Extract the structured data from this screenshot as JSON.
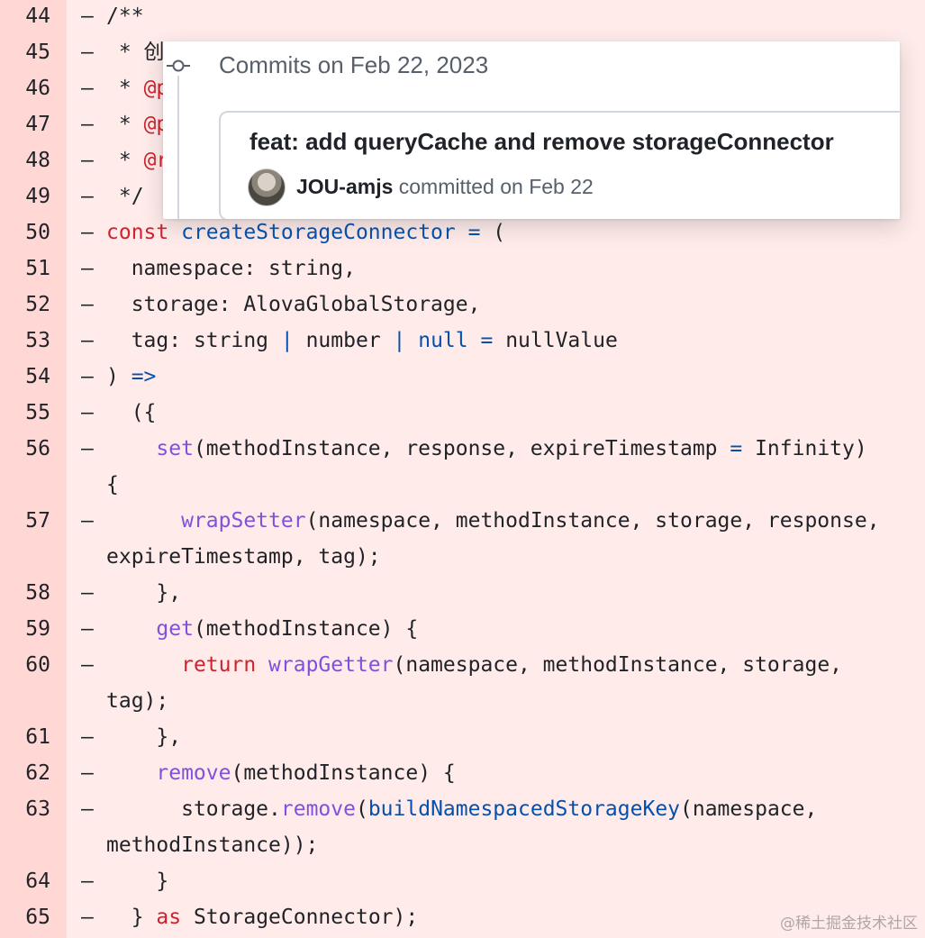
{
  "diff": {
    "rows": [
      {
        "ln": "44",
        "marker": "–",
        "tokens": [
          {
            "t": "/**",
            "c": "plain"
          }
        ]
      },
      {
        "ln": "45",
        "marker": "–",
        "tokens": [
          {
            "t": " * 创",
            "c": "plain"
          }
        ]
      },
      {
        "ln": "46",
        "marker": "–",
        "tokens": [
          {
            "t": " * ",
            "c": "plain"
          },
          {
            "t": "@p",
            "c": "kw"
          }
        ]
      },
      {
        "ln": "47",
        "marker": "–",
        "tokens": [
          {
            "t": " * ",
            "c": "plain"
          },
          {
            "t": "@p",
            "c": "kw"
          }
        ]
      },
      {
        "ln": "48",
        "marker": "–",
        "tokens": [
          {
            "t": " * ",
            "c": "plain"
          },
          {
            "t": "@r",
            "c": "kw"
          }
        ]
      },
      {
        "ln": "49",
        "marker": "–",
        "tokens": [
          {
            "t": " */",
            "c": "plain"
          }
        ]
      },
      {
        "ln": "50",
        "marker": "–",
        "tokens": [
          {
            "t": "const ",
            "c": "kw"
          },
          {
            "t": "createStorageConnector",
            "c": "const"
          },
          {
            "t": " = ",
            "c": "const"
          },
          {
            "t": "(",
            "c": "plain"
          }
        ]
      },
      {
        "ln": "51",
        "marker": "–",
        "tokens": [
          {
            "t": "  namespace: string,",
            "c": "plain"
          }
        ]
      },
      {
        "ln": "52",
        "marker": "–",
        "tokens": [
          {
            "t": "  storage: AlovaGlobalStorage,",
            "c": "plain"
          }
        ]
      },
      {
        "ln": "53",
        "marker": "–",
        "tokens": [
          {
            "t": "  tag: string ",
            "c": "plain"
          },
          {
            "t": "|",
            "c": "const"
          },
          {
            "t": " number ",
            "c": "plain"
          },
          {
            "t": "|",
            "c": "const"
          },
          {
            "t": " ",
            "c": "plain"
          },
          {
            "t": "null",
            "c": "const"
          },
          {
            "t": " ",
            "c": "plain"
          },
          {
            "t": "=",
            "c": "const"
          },
          {
            "t": " nullValue",
            "c": "plain"
          }
        ]
      },
      {
        "ln": "54",
        "marker": "–",
        "tokens": [
          {
            "t": ") ",
            "c": "plain"
          },
          {
            "t": "=>",
            "c": "const"
          }
        ]
      },
      {
        "ln": "55",
        "marker": "–",
        "tokens": [
          {
            "t": "  ({",
            "c": "plain"
          }
        ]
      },
      {
        "ln": "56",
        "marker": "–",
        "tokens": [
          {
            "t": "    ",
            "c": "plain"
          },
          {
            "t": "set",
            "c": "fn"
          },
          {
            "t": "(methodInstance, response, expireTimestamp ",
            "c": "plain"
          },
          {
            "t": "=",
            "c": "const"
          },
          {
            "t": " Infinity)",
            "c": "plain"
          }
        ],
        "wrap": [
          {
            "t": "{",
            "c": "plain"
          }
        ]
      },
      {
        "ln": "57",
        "marker": "–",
        "tokens": [
          {
            "t": "      ",
            "c": "plain"
          },
          {
            "t": "wrapSetter",
            "c": "fn"
          },
          {
            "t": "(namespace, methodInstance, storage, response,",
            "c": "plain"
          }
        ],
        "wrap": [
          {
            "t": "expireTimestamp, tag);",
            "c": "plain"
          }
        ]
      },
      {
        "ln": "58",
        "marker": "–",
        "tokens": [
          {
            "t": "    },",
            "c": "plain"
          }
        ]
      },
      {
        "ln": "59",
        "marker": "–",
        "tokens": [
          {
            "t": "    ",
            "c": "plain"
          },
          {
            "t": "get",
            "c": "fn"
          },
          {
            "t": "(methodInstance) {",
            "c": "plain"
          }
        ]
      },
      {
        "ln": "60",
        "marker": "–",
        "tokens": [
          {
            "t": "      ",
            "c": "plain"
          },
          {
            "t": "return ",
            "c": "kw"
          },
          {
            "t": "wrapGetter",
            "c": "fn"
          },
          {
            "t": "(namespace, methodInstance, storage,",
            "c": "plain"
          }
        ],
        "wrap": [
          {
            "t": "tag);",
            "c": "plain"
          }
        ]
      },
      {
        "ln": "61",
        "marker": "–",
        "tokens": [
          {
            "t": "    },",
            "c": "plain"
          }
        ]
      },
      {
        "ln": "62",
        "marker": "–",
        "tokens": [
          {
            "t": "    ",
            "c": "plain"
          },
          {
            "t": "remove",
            "c": "fn"
          },
          {
            "t": "(methodInstance) {",
            "c": "plain"
          }
        ]
      },
      {
        "ln": "63",
        "marker": "–",
        "tokens": [
          {
            "t": "      storage.",
            "c": "plain"
          },
          {
            "t": "remove",
            "c": "fn"
          },
          {
            "t": "(",
            "c": "plain"
          },
          {
            "t": "buildNamespacedStorageKey",
            "c": "const"
          },
          {
            "t": "(namespace,",
            "c": "plain"
          }
        ],
        "wrap": [
          {
            "t": "methodInstance));",
            "c": "plain"
          }
        ]
      },
      {
        "ln": "64",
        "marker": "–",
        "tokens": [
          {
            "t": "    }",
            "c": "plain"
          }
        ]
      },
      {
        "ln": "65",
        "marker": "–",
        "tokens": [
          {
            "t": "  } ",
            "c": "plain"
          },
          {
            "t": "as ",
            "c": "kw"
          },
          {
            "t": "StorageConnector);",
            "c": "plain"
          }
        ]
      }
    ]
  },
  "popover": {
    "heading": "Commits on Feb 22, 2023",
    "icon": "git-commit-icon",
    "commit": {
      "title": "feat: add queryCache and remove storageConnector",
      "author": "JOU-amjs",
      "action_text": " committed on Feb 22"
    }
  },
  "watermark": "@稀土掘金技术社区",
  "colors": {
    "background": "#ffebe9",
    "gutter": "#ffd7d5",
    "keyword": "#cf222e",
    "function": "#8250df",
    "constant": "#0550ae",
    "text": "#1f2328",
    "muted": "#57606a"
  }
}
